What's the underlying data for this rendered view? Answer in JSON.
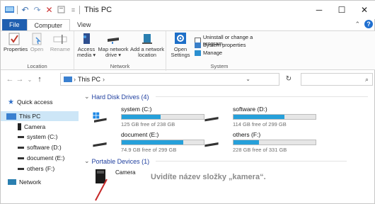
{
  "window": {
    "title": "This PC",
    "quick_access_glyphs": [
      "↶",
      "↷",
      "✕"
    ]
  },
  "tabs": [
    {
      "label": "File"
    },
    {
      "label": "Computer"
    },
    {
      "label": "View"
    }
  ],
  "ribbon": {
    "location": {
      "name": "Location",
      "properties": "Properties",
      "open": "Open",
      "rename": "Rename"
    },
    "network": {
      "name": "Network",
      "access_media": [
        "Access",
        "media ▾"
      ],
      "map_drive": [
        "Map network",
        "drive ▾"
      ],
      "add_location": [
        "Add a network",
        "location"
      ]
    },
    "system": {
      "name": "System",
      "open_settings": [
        "Open",
        "Settings"
      ],
      "uninstall": "Uninstall or change a program",
      "system_properties": "System properties",
      "manage": "Manage"
    }
  },
  "address": {
    "path": "This PC",
    "separator": "›"
  },
  "nav": {
    "quick_access": "Quick access",
    "this_pc": "This PC",
    "camera": "Camera",
    "system_c": "system (C:)",
    "software_d": "software (D:)",
    "document_e": "document (E:)",
    "others_f": "others (F:)",
    "network": "Network"
  },
  "content": {
    "hdd_header": "Hard Disk Drives (4)",
    "portable_header": "Portable Devices (1)",
    "drives": [
      {
        "name": "system (C:)",
        "free": "125 GB free of 238 GB",
        "used_fraction": 0.47
      },
      {
        "name": "software (D:)",
        "free": "114 GB free of 299 GB",
        "used_fraction": 0.62
      },
      {
        "name": "document (E:)",
        "free": "74.9 GB free of 299 GB",
        "used_fraction": 0.75
      },
      {
        "name": "others (F:)",
        "free": "228 GB free of 331 GB",
        "used_fraction": 0.31
      }
    ],
    "device_name": "Camera",
    "caption": "Uvidíte název složky „kamera“."
  },
  "colors": {
    "accent": "#1f5fb0",
    "drive_bar": "#26a0da",
    "selection": "#cde6f7",
    "section_header": "#1f3f9f"
  }
}
